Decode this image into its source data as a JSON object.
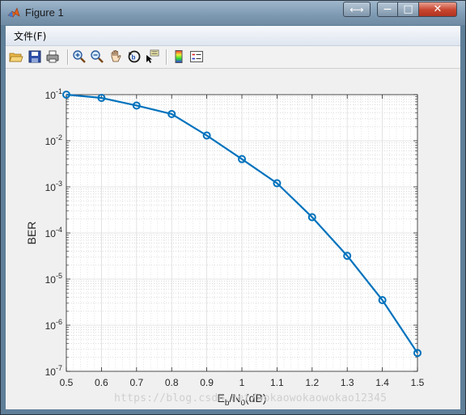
{
  "window": {
    "title": "Figure 1",
    "title_button_extra": "⟷",
    "minimize": "—",
    "maximize": "□",
    "close": "✕"
  },
  "menu": {
    "file": "文件(F)"
  },
  "toolbar": {
    "icons": [
      "open-file-icon",
      "save-icon",
      "print-icon",
      "zoom-in-icon",
      "zoom-out-icon",
      "pan-hand-icon",
      "rotate-3d-icon",
      "data-cursor-icon",
      "colorbar-icon",
      "legend-icon"
    ]
  },
  "chart_data": {
    "type": "line",
    "xlabel": "E_b/N_0(dB)",
    "xlabel_parts": {
      "E": "E",
      "b": "b",
      "slash": "/N",
      "zero": "0",
      "unit": "(dB)"
    },
    "ylabel": "BER",
    "yscale": "log",
    "xlim": [
      0.5,
      1.5
    ],
    "ylim": [
      1e-07,
      0.1
    ],
    "grid": true,
    "minor_grid": true,
    "x_ticks": [
      "0.5",
      "0.6",
      "0.7",
      "0.8",
      "0.9",
      "1",
      "1.1",
      "1.2",
      "1.3",
      "1.4",
      "1.5"
    ],
    "y_tick_exponents": [
      "-1",
      "-2",
      "-3",
      "-4",
      "-5",
      "-6",
      "-7"
    ],
    "y_tick_base": "10",
    "series": [
      {
        "color": "#0072BD",
        "marker": "circle",
        "x": [
          0.5,
          0.6,
          0.7,
          0.8,
          0.9,
          1.0,
          1.1,
          1.2,
          1.3,
          1.4,
          1.5
        ],
        "y": [
          0.1,
          0.085,
          0.058,
          0.038,
          0.013,
          0.004,
          0.0012,
          0.00022,
          3.2e-05,
          3.5e-06,
          2.5e-07
        ]
      }
    ]
  },
  "watermark": "https://blog.csdn.net/wokaowokaowokao12345"
}
